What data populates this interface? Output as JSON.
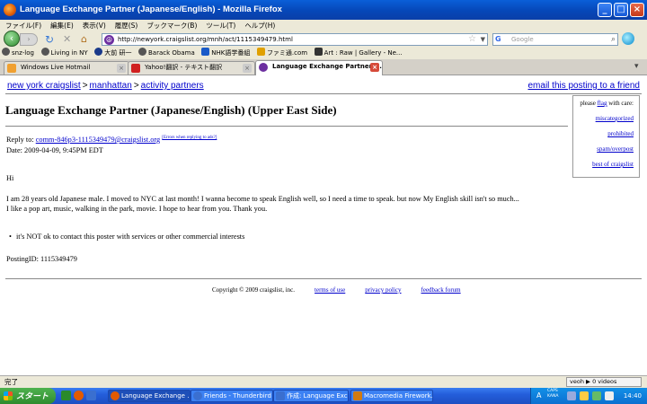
{
  "window": {
    "title": "Language Exchange Partner (Japanese/English) - Mozilla Firefox",
    "minimize": "_",
    "maximize": "□",
    "close": "×"
  },
  "menu": [
    "ファイル(F)",
    "編集(E)",
    "表示(V)",
    "履歴(S)",
    "ブックマーク(B)",
    "ツール(T)",
    "ヘルプ(H)"
  ],
  "nav": {
    "back": "‹",
    "forward": "›",
    "reload": "↻",
    "stop": "✕",
    "home": "⌂",
    "url": "http://newyork.craigslist.org/mnh/act/1115349479.html",
    "search_placeholder": "Google"
  },
  "bookmarks": [
    {
      "label": "snz-log",
      "icon": "gear-icon",
      "color": "#444444"
    },
    {
      "label": "Living in NY",
      "icon": "gear-icon",
      "color": "#444444"
    },
    {
      "label": "大前 研一",
      "icon": "globe-icon",
      "color": "#1a3a8a"
    },
    {
      "label": "Barack Obama",
      "icon": "gear-icon",
      "color": "#444444"
    },
    {
      "label": "NHK語学番組",
      "icon": "nhk-icon",
      "color": "#1a5ac8"
    },
    {
      "label": "ファミ通.com",
      "icon": "famitsu-icon",
      "color": "#e0a000"
    },
    {
      "label": "Art : Raw | Gallery - Ne...",
      "icon": "art-icon",
      "color": "#333333"
    }
  ],
  "tabs": [
    {
      "label": "Windows Live Hotmail",
      "color": "#f0a030",
      "active": false
    },
    {
      "label": "Yahoo!翻訳 - テキスト翻訳",
      "color": "#d02020",
      "active": false
    },
    {
      "label": "Language Exchange Partner (J...",
      "color": "#6c2fa0",
      "active": true
    }
  ],
  "page": {
    "crumbs": [
      "new york craigslist",
      "manhattan",
      "activity partners"
    ],
    "crumb_sep": ">",
    "email_post": "email this posting to a friend",
    "title": "Language Exchange Partner (Japanese/English) (Upper East Side)",
    "flag": {
      "heading_pre": "please ",
      "heading_link": "flag",
      "heading_post": " with care:",
      "links": [
        "miscategorized",
        "prohibited",
        "spam/overpost",
        "best of craigslist"
      ]
    },
    "reply_label": "Reply to: ",
    "reply_email": "comm-846p3-1115349479@craigslist.org",
    "reply_note": "[Errors when replying to ads?]",
    "date": "Date: 2009-04-09, 9:45PM EDT",
    "greeting": "Hi",
    "para1": "I am 28 years old Japanese male. I moved to NYC at last month! I wanna become to speak English well, so I need a time to speak. but now My English skill isn't so much...",
    "para2": "I like a pop art, music, walking in the park, movie. I hope to hear from you. Thank you.",
    "notice": "it's NOT ok to contact this poster with services or other commercial interests",
    "posting_id": "PostingID: 1115349479",
    "footer": {
      "copyright": "Copyright © 2009 craigslist, inc.",
      "links": [
        "terms of use",
        "privacy policy",
        "feedback forum"
      ]
    }
  },
  "status": {
    "text": "完了",
    "veoh": "veoh ▶ 0 videos"
  },
  "taskbar": {
    "start": "スタート",
    "items": [
      {
        "label": "Language Exchange ...",
        "color": "#e25a00",
        "active": true
      },
      {
        "label": "Friends - Thunderbird",
        "color": "#3a6fd0",
        "active": false
      },
      {
        "label": "作成: Language Exch...",
        "color": "#3a6fd0",
        "active": false
      },
      {
        "label": "Macromedia Firework...",
        "color": "#d07a10",
        "active": false
      }
    ],
    "ime": "A",
    "ime_caps": "CAPS\nKANA",
    "clock": "14:40"
  }
}
